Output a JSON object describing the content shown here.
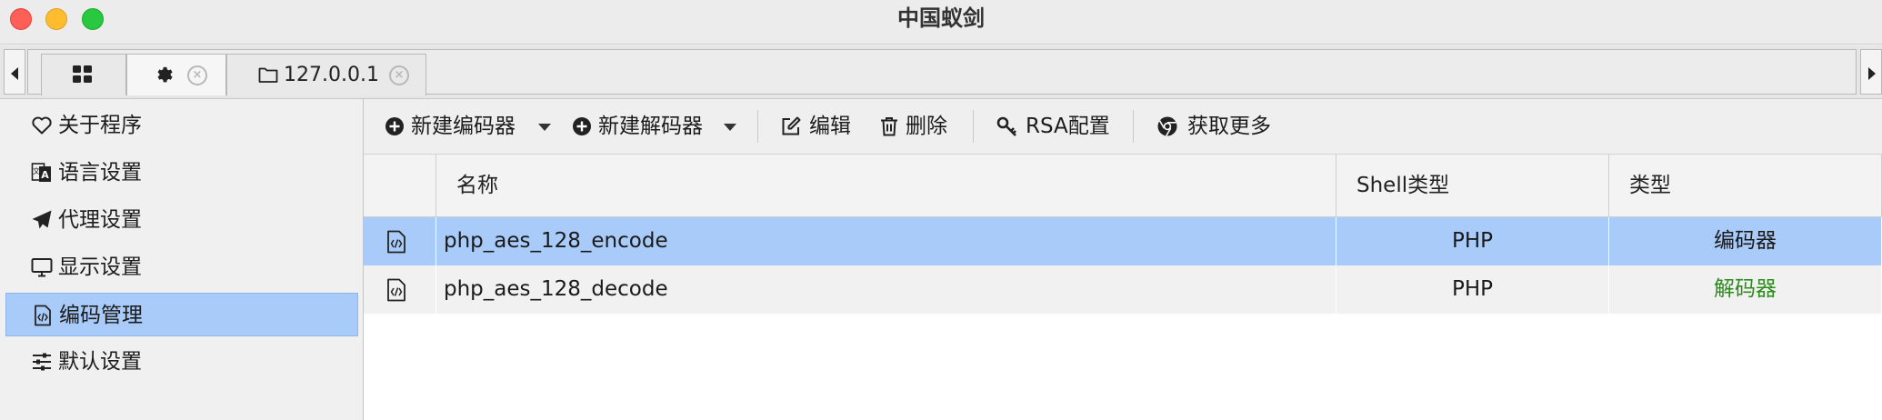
{
  "window": {
    "title": "中国蚁剑"
  },
  "tabs": [
    {
      "icon": "grid-icon",
      "label": ""
    },
    {
      "icon": "gear-icon",
      "label": ""
    },
    {
      "icon": "folder-icon",
      "label": "127.0.0.1"
    }
  ],
  "sidebar": {
    "items": [
      {
        "icon": "heart-icon",
        "label": "关于程序"
      },
      {
        "icon": "translate-icon",
        "label": "语言设置"
      },
      {
        "icon": "paper-plane-icon",
        "label": "代理设置"
      },
      {
        "icon": "monitor-icon",
        "label": "显示设置"
      },
      {
        "icon": "code-file-icon",
        "label": "编码管理",
        "selected": true
      },
      {
        "icon": "sliders-icon",
        "label": "默认设置"
      }
    ]
  },
  "toolbar": {
    "new_encoder": "新建编码器",
    "new_decoder": "新建解码器",
    "edit": "编辑",
    "delete": "删除",
    "rsa": "RSA配置",
    "more": "获取更多"
  },
  "grid": {
    "columns": [
      "",
      "名称",
      "Shell类型",
      "类型"
    ],
    "rows": [
      {
        "name": "php_aes_128_encode",
        "shell_type": "PHP",
        "type": "编码器",
        "type_color": "#1a1a1a",
        "selected": true
      },
      {
        "name": "php_aes_128_decode",
        "shell_type": "PHP",
        "type": "解码器",
        "type_color": "#2e8b1e",
        "selected": false
      }
    ]
  },
  "colors": {
    "selection": "#a9cbfa",
    "decoder_green": "#2e8b1e"
  }
}
